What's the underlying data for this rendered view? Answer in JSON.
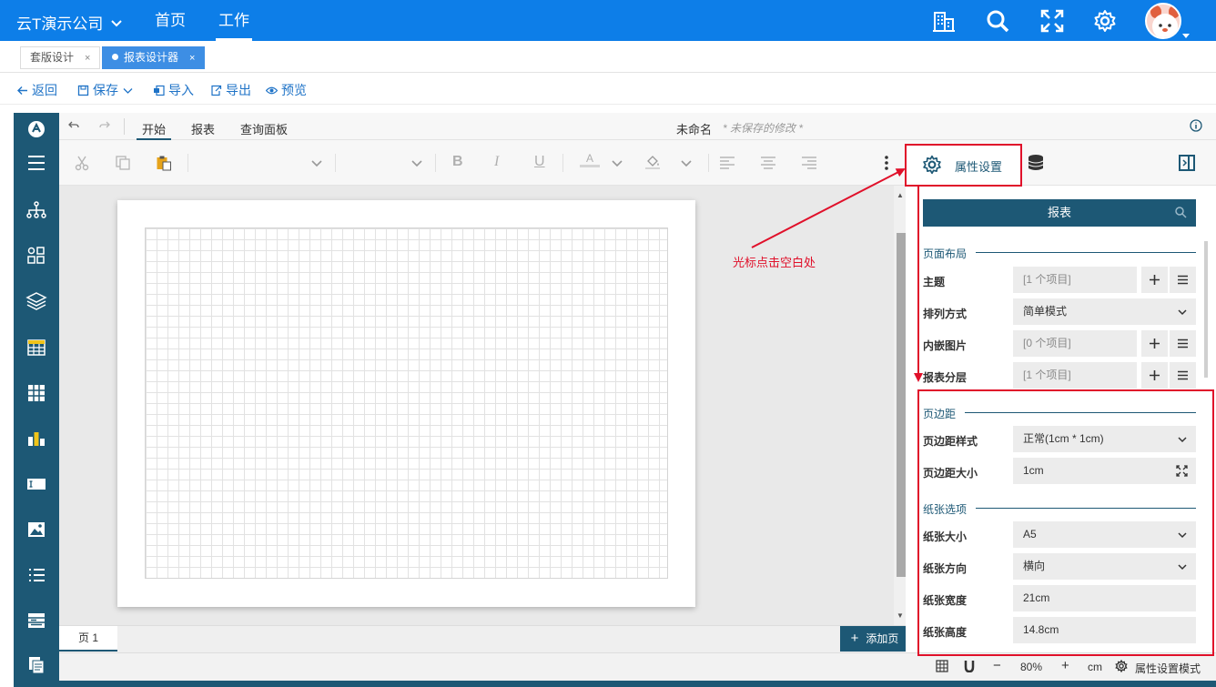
{
  "topbar": {
    "company": "云T演示公司",
    "nav": [
      {
        "label": "首页",
        "active": false
      },
      {
        "label": "工作",
        "active": true
      }
    ],
    "icons": [
      "building-icon",
      "search-icon",
      "fullscreen-icon",
      "settings-icon"
    ],
    "bg_color": "#0d7ee8"
  },
  "tabs": [
    {
      "label": "套版设计",
      "close": "×",
      "active": false
    },
    {
      "label": "报表设计器",
      "close": "×",
      "active": true
    }
  ],
  "actions": {
    "back": "返回",
    "save": "保存",
    "import": "导入",
    "export": "导出",
    "preview": "预览"
  },
  "menubar": {
    "items": [
      "开始",
      "报表",
      "查询面板"
    ],
    "doc_name": "未命名",
    "unsaved": "* 未保存的修改 *"
  },
  "toolbar": {
    "bold": "B",
    "italic": "I",
    "underline": "U",
    "font_color": "A"
  },
  "page_tabs": {
    "tab": "页 1",
    "add": "添加页"
  },
  "statusbar": {
    "zoom": "80%",
    "unit": "cm",
    "mode": "属性设置模式",
    "minus": "−",
    "plus": "+"
  },
  "panel": {
    "tab_label": "属性设置",
    "search_label": "报表",
    "sections": {
      "layout": "页面布局",
      "margin": "页边距",
      "paper": "纸张选项"
    },
    "rows": {
      "theme": {
        "label": "主题",
        "value": "[1 个项目]"
      },
      "arrange": {
        "label": "排列方式",
        "value": "简单模式"
      },
      "images": {
        "label": "内嵌图片",
        "value": "[0 个项目]"
      },
      "layers": {
        "label": "报表分层",
        "value": "[1 个项目]"
      },
      "margin_style": {
        "label": "页边距样式",
        "value": "正常(1cm * 1cm)"
      },
      "margin_size": {
        "label": "页边距大小",
        "value": "1cm"
      },
      "paper_size": {
        "label": "纸张大小",
        "value": "A5"
      },
      "orientation": {
        "label": "纸张方向",
        "value": "横向"
      },
      "paper_width": {
        "label": "纸张宽度",
        "value": "21cm"
      },
      "paper_height": {
        "label": "纸张高度",
        "value": "14.8cm"
      }
    }
  },
  "annotation": {
    "text": "光标点击空白处",
    "color": "#e0102a"
  },
  "accent_color": "#1d5875"
}
